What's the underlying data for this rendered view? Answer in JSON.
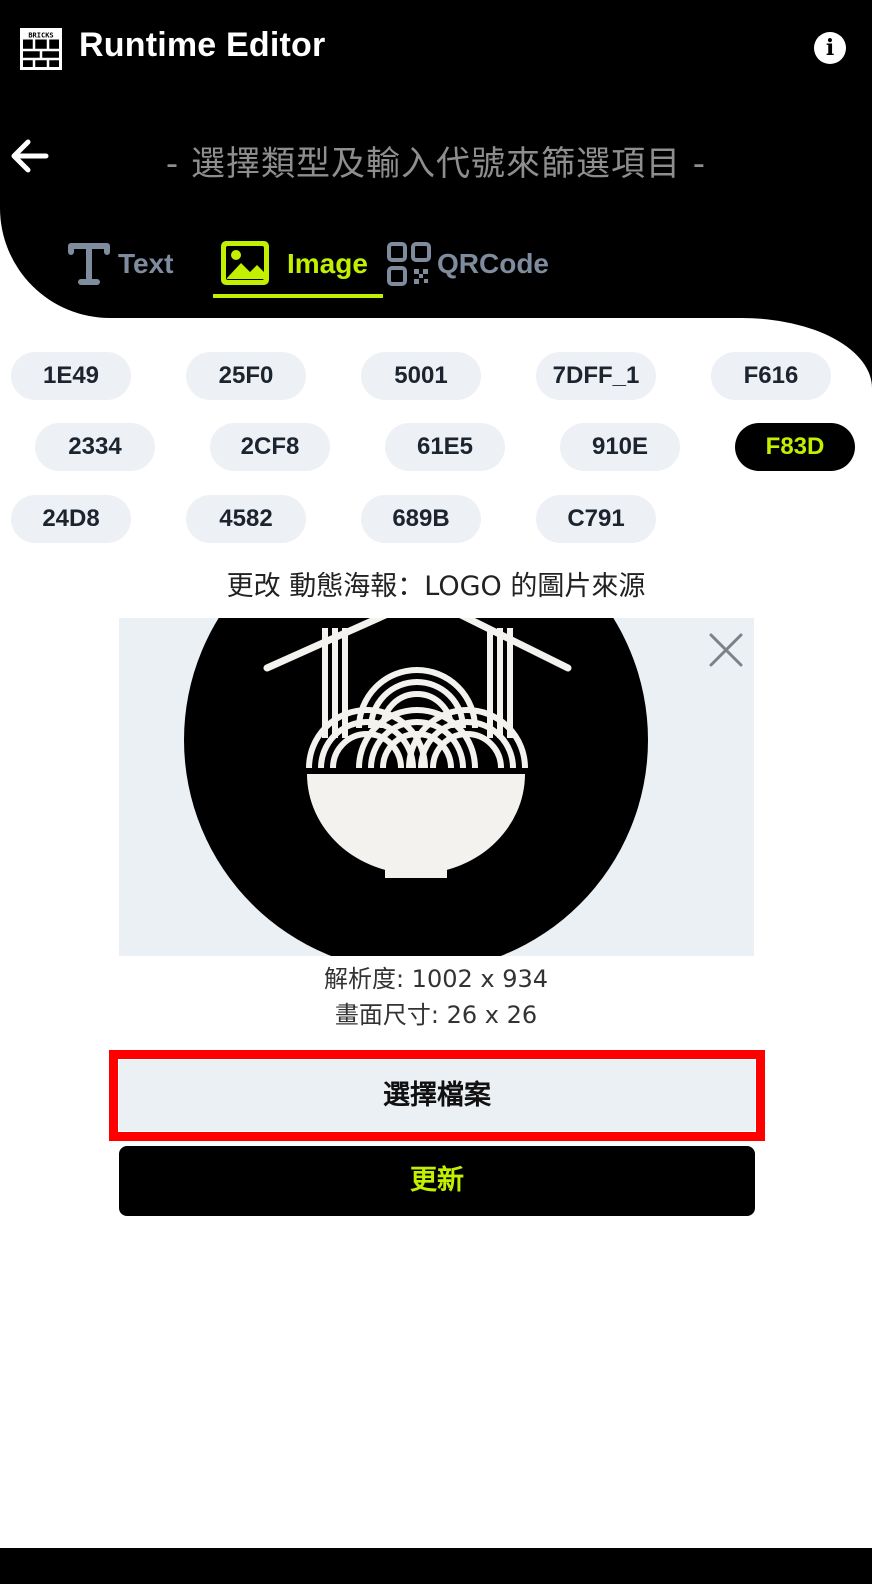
{
  "app": {
    "title": "Runtime Editor",
    "logo_text": "BRICKS"
  },
  "header": {
    "subtitle": "- 選擇類型及輸入代號來篩選項目 -"
  },
  "tabs": [
    {
      "label": "Text",
      "active": false
    },
    {
      "label": "Image",
      "active": true
    },
    {
      "label": "QRCode",
      "active": false
    }
  ],
  "chips": [
    {
      "label": "1E49",
      "active": false
    },
    {
      "label": "25F0",
      "active": false
    },
    {
      "label": "5001",
      "active": false
    },
    {
      "label": "7DFF_1",
      "active": false
    },
    {
      "label": "F616",
      "active": false
    },
    {
      "label": "2334",
      "active": false
    },
    {
      "label": "2CF8",
      "active": false
    },
    {
      "label": "61E5",
      "active": false
    },
    {
      "label": "910E",
      "active": false
    },
    {
      "label": "F83D",
      "active": true
    },
    {
      "label": "24D8",
      "active": false
    },
    {
      "label": "4582",
      "active": false
    },
    {
      "label": "689B",
      "active": false
    },
    {
      "label": "C791",
      "active": false
    }
  ],
  "editor": {
    "caption": "更改 動態海報：LOGO 的圖片來源",
    "resolution": "解析度: 1002 x 934",
    "canvas_size": "畫面尺寸: 26 x 26",
    "choose_file_label": "選擇檔案",
    "update_label": "更新"
  },
  "colors": {
    "accent": "#c2f000",
    "header_bg": "#000000",
    "chip_bg": "#edf0f4",
    "preview_bg": "#ebf0f5",
    "highlight": "#ff0000"
  },
  "icons": {
    "logo": "bricks-logo-icon",
    "info": "info-icon",
    "back": "arrow-left-icon",
    "text_tab": "text-type-icon",
    "image_tab": "image-icon",
    "qr_tab": "qrcode-icon",
    "close": "close-icon"
  }
}
